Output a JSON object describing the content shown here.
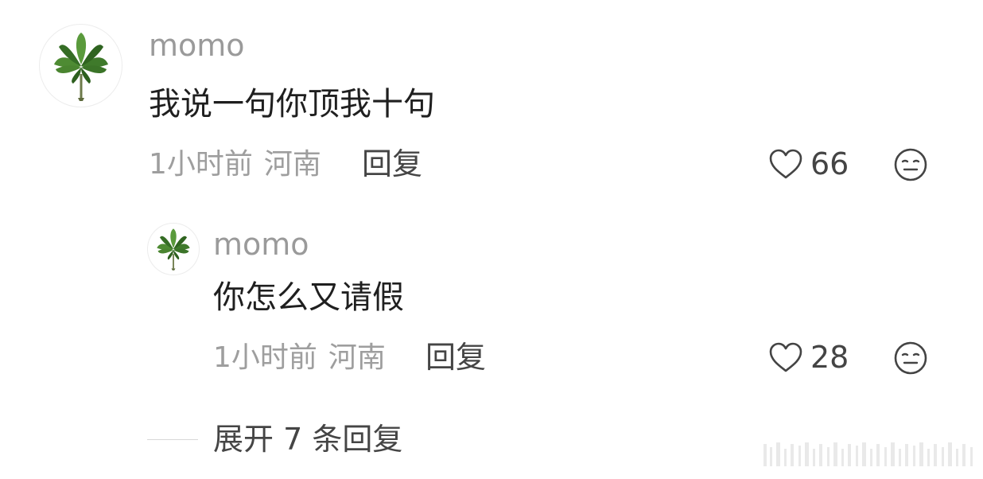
{
  "comment": {
    "username": "momo",
    "text": "我说一句你顶我十句",
    "time": "1小时前",
    "location": "河南",
    "reply_label": "回复",
    "like_count": "66"
  },
  "reply": {
    "username": "momo",
    "text": "你怎么又请假",
    "time": "1小时前",
    "location": "河南",
    "reply_label": "回复",
    "like_count": "28"
  },
  "expand_replies_label": "展开 7 条回复",
  "icons": {
    "avatar": "leaf-bundle-avatar",
    "like": "heart-outline-icon",
    "dislike": "meh-face-icon"
  },
  "colors": {
    "username": "#9a9a9a",
    "content": "#1f1f1f",
    "meta": "#9e9e9e",
    "action": "#454545",
    "leaf": "#3f7a2b"
  }
}
